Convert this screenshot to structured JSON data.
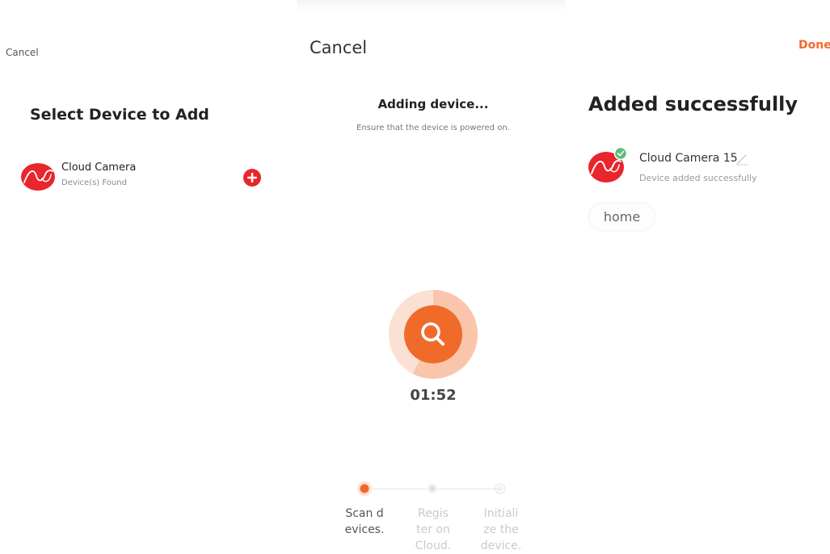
{
  "panel_select": {
    "cancel": "Cancel",
    "title": "Select Device to Add",
    "device": {
      "name": "Cloud Camera",
      "status": "Device(s) Found",
      "icon": "cloud-camera-logo"
    },
    "add_icon": "plus-circle-icon"
  },
  "panel_adding": {
    "cancel": "Cancel",
    "title": "Adding device...",
    "subtitle": "Ensure that the device is powered on.",
    "timer": "01:52",
    "scan_icon": "search-icon",
    "steps": [
      {
        "line1": "Scan d",
        "line2": "evices.",
        "line3": "",
        "state": "active"
      },
      {
        "line1": "Regis",
        "line2": "ter on",
        "line3": "Cloud.",
        "state": "pending"
      },
      {
        "line1": "Initiali",
        "line2": "ze the",
        "line3": "device.",
        "state": "pending"
      }
    ]
  },
  "panel_added": {
    "done": "Done",
    "title": "Added successfully",
    "device_name": "Cloud Camera 15",
    "device_status": "Device added successfully",
    "room_chip": "home",
    "edit_icon": "pencil-icon",
    "check_icon": "check-badge-icon"
  },
  "colors": {
    "accent_orange": "#f06a2a",
    "brand_red": "#e8262c",
    "success_green": "#5cbf79",
    "step_active": "#f06a2a",
    "step_pending": "#d6d6d6"
  }
}
